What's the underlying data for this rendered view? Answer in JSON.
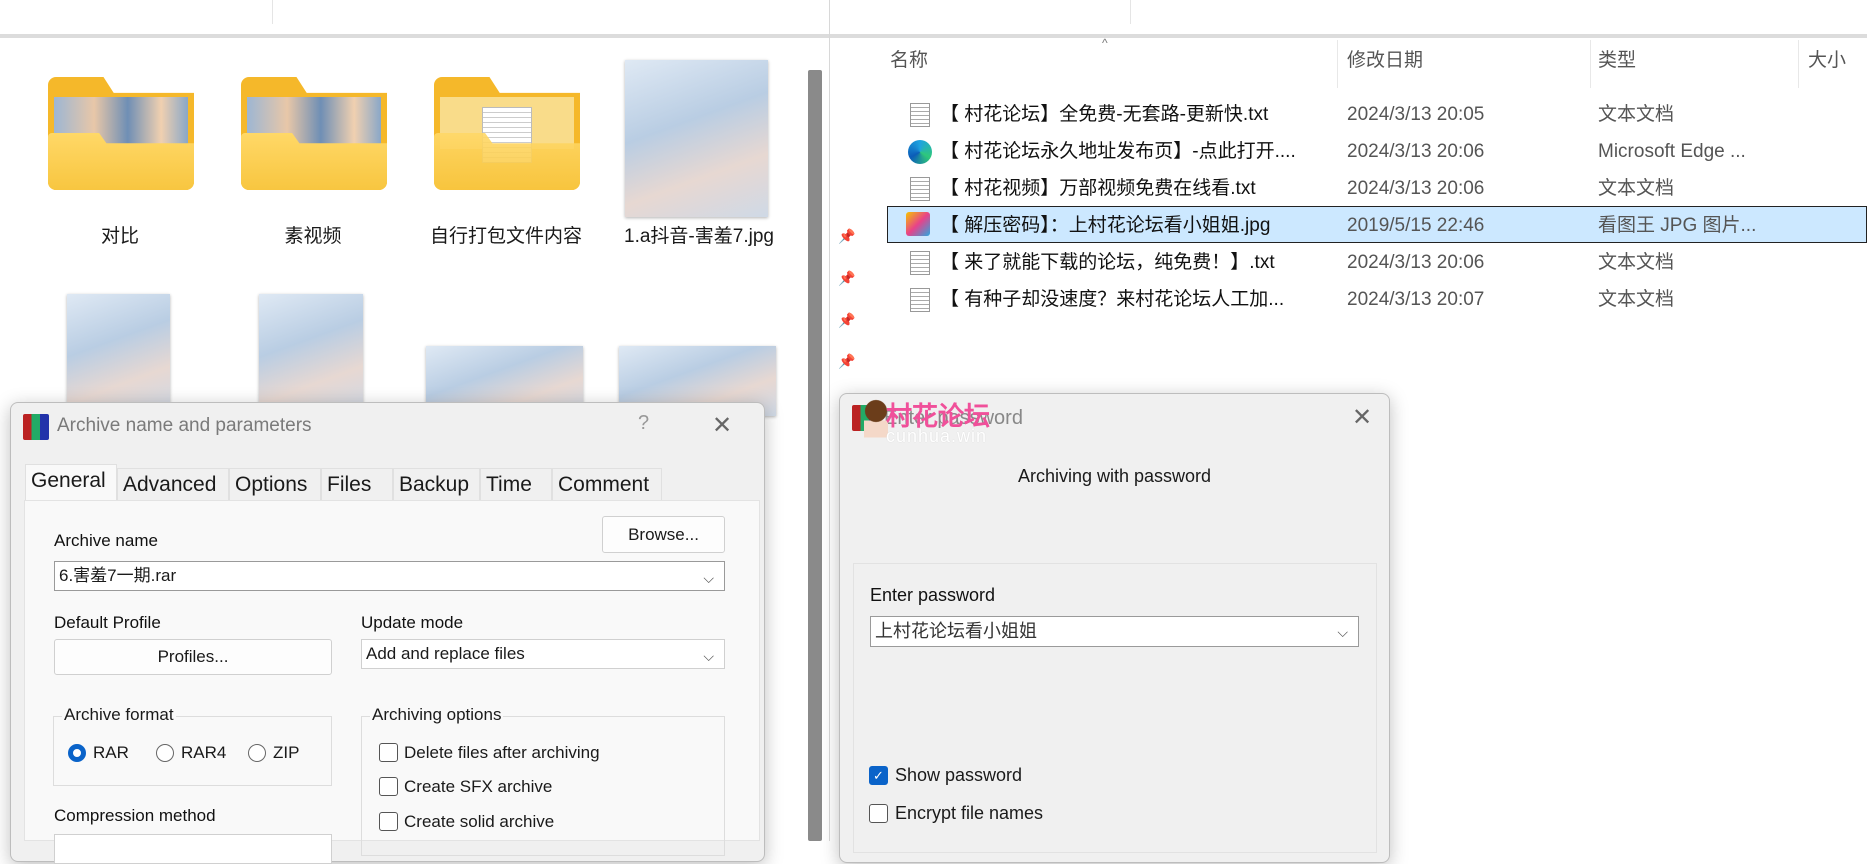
{
  "left_explorer": {
    "items": [
      {
        "label": "对比",
        "kind": "folder"
      },
      {
        "label": "素视频",
        "kind": "folder"
      },
      {
        "label": "自行打包文件内容",
        "kind": "folder-doc"
      },
      {
        "label": "1.a抖音-害羞7.jpg",
        "kind": "image"
      }
    ]
  },
  "right_explorer": {
    "columns": {
      "name": "名称",
      "modified": "修改日期",
      "type": "类型",
      "size": "大小"
    },
    "rows": [
      {
        "icon": "text-file-icon",
        "name": "【 村花论坛】全免费-无套路-更新快.txt",
        "date": "2024/3/13 20:05",
        "type": "文本文档",
        "selected": false
      },
      {
        "icon": "edge-icon",
        "name": "【 村花论坛永久地址发布页】-点此打开....",
        "date": "2024/3/13 20:06",
        "type": "Microsoft Edge ...",
        "selected": false
      },
      {
        "icon": "text-file-icon",
        "name": "【 村花视频】万部视频免费在线看.txt",
        "date": "2024/3/13 20:06",
        "type": "文本文档",
        "selected": false
      },
      {
        "icon": "image-viewer-icon",
        "name": "【 解压密码】：上村花论坛看小姐姐.jpg",
        "date": "2019/5/15 22:46",
        "type": "看图王 JPG 图片...",
        "selected": true
      },
      {
        "icon": "text-file-icon",
        "name": "【 来了就能下载的论坛，纯免费！】.txt",
        "date": "2024/3/13 20:06",
        "type": "文本文档",
        "selected": false
      },
      {
        "icon": "text-file-icon",
        "name": "【 有种子却没速度？来村花论坛人工加...",
        "date": "2024/3/13 20:07",
        "type": "文本文档",
        "selected": false
      }
    ]
  },
  "archive_dialog": {
    "title": "Archive name and parameters",
    "help": "?",
    "close": "✕",
    "tabs": [
      "General",
      "Advanced",
      "Options",
      "Files",
      "Backup",
      "Time",
      "Comment"
    ],
    "active_tab": "General",
    "archive_name_label": "Archive name",
    "browse": "Browse...",
    "archive_name_value": "6.害羞7一期.rar",
    "default_profile_label": "Default Profile",
    "profiles": "Profiles...",
    "update_mode_label": "Update mode",
    "update_mode_value": "Add and replace files",
    "archive_format_label": "Archive format",
    "formats": [
      "RAR",
      "RAR4",
      "ZIP"
    ],
    "selected_format": "RAR",
    "archiving_options_label": "Archiving options",
    "options": [
      {
        "label": "Delete files after archiving",
        "checked": false
      },
      {
        "label": "Create SFX archive",
        "checked": false
      },
      {
        "label": "Create solid archive",
        "checked": false
      }
    ],
    "compression_method_label": "Compression method"
  },
  "password_dialog": {
    "title": "Enter password",
    "close": "✕",
    "heading": "Archiving with password",
    "enter_password_label": "Enter password",
    "password_value": "上村花论坛看小姐姐",
    "show_password": {
      "label": "Show password",
      "checked": true
    },
    "encrypt_names": {
      "label": "Encrypt file names",
      "checked": false
    }
  },
  "watermark": {
    "title": "村花论坛",
    "url": "cunhua.win",
    "color": "#f0509a"
  },
  "colors": {
    "accent": "#0a63c9",
    "selection": "#cce8ff"
  }
}
